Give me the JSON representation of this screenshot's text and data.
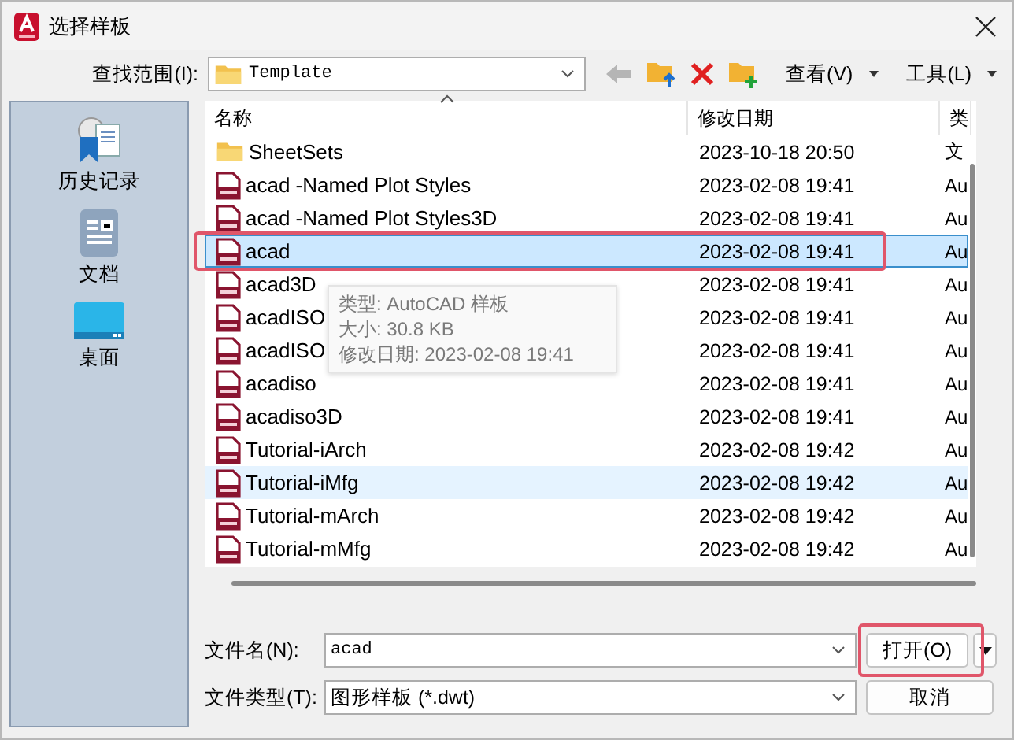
{
  "window": {
    "title": "选择样板"
  },
  "toolbar": {
    "look_in_label": "查找范围(I):",
    "look_in_value": "Template",
    "back_disabled": true,
    "view_menu": "查看(V)",
    "tools_menu": "工具(L)"
  },
  "places": [
    {
      "label": "历史记录",
      "kind": "history"
    },
    {
      "label": "文档",
      "kind": "documents"
    },
    {
      "label": "桌面",
      "kind": "desktop"
    }
  ],
  "file_list": {
    "columns": [
      "名称",
      "修改日期",
      "类"
    ],
    "rows": [
      {
        "name": "SheetSets",
        "kind": "folder",
        "modified": "2023-10-18 20:50",
        "type": "文",
        "selected": false,
        "hovered": false,
        "annotated": false
      },
      {
        "name": "acad -Named Plot Styles",
        "kind": "dwt",
        "modified": "2023-02-08 19:41",
        "type": "Au",
        "selected": false,
        "hovered": false,
        "annotated": false
      },
      {
        "name": "acad -Named Plot Styles3D",
        "kind": "dwt",
        "modified": "2023-02-08 19:41",
        "type": "Au",
        "selected": false,
        "hovered": false,
        "annotated": false
      },
      {
        "name": "acad",
        "kind": "dwt",
        "modified": "2023-02-08 19:41",
        "type": "Au",
        "selected": true,
        "hovered": false,
        "annotated": true
      },
      {
        "name": "acad3D",
        "kind": "dwt",
        "modified": "2023-02-08 19:41",
        "type": "Au",
        "selected": false,
        "hovered": false,
        "annotated": false
      },
      {
        "name": "acadISO",
        "kind": "dwt",
        "modified": "2023-02-08 19:41",
        "type": "Au",
        "selected": false,
        "hovered": false,
        "annotated": false
      },
      {
        "name": "acadISO",
        "kind": "dwt",
        "modified": "2023-02-08 19:41",
        "type": "Au",
        "selected": false,
        "hovered": false,
        "annotated": false
      },
      {
        "name": "acadiso",
        "kind": "dwt",
        "modified": "2023-02-08 19:41",
        "type": "Au",
        "selected": false,
        "hovered": false,
        "annotated": false
      },
      {
        "name": "acadiso3D",
        "kind": "dwt",
        "modified": "2023-02-08 19:41",
        "type": "Au",
        "selected": false,
        "hovered": false,
        "annotated": false
      },
      {
        "name": "Tutorial-iArch",
        "kind": "dwt",
        "modified": "2023-02-08 19:42",
        "type": "Au",
        "selected": false,
        "hovered": false,
        "annotated": false
      },
      {
        "name": "Tutorial-iMfg",
        "kind": "dwt",
        "modified": "2023-02-08 19:42",
        "type": "Au",
        "selected": false,
        "hovered": true,
        "annotated": false
      },
      {
        "name": "Tutorial-mArch",
        "kind": "dwt",
        "modified": "2023-02-08 19:42",
        "type": "Au",
        "selected": false,
        "hovered": false,
        "annotated": false
      },
      {
        "name": "Tutorial-mMfg",
        "kind": "dwt",
        "modified": "2023-02-08 19:42",
        "type": "Au",
        "selected": false,
        "hovered": false,
        "annotated": false
      }
    ]
  },
  "tooltip": {
    "lines": [
      "类型: AutoCAD 样板",
      "大小: 30.8 KB",
      "修改日期: 2023-02-08 19:41"
    ]
  },
  "file_name": {
    "label": "文件名(N):",
    "value": "acad"
  },
  "file_type": {
    "label": "文件类型(T):",
    "value": "图形样板 (*.dwt)"
  },
  "buttons": [
    {
      "label": "打开(O)",
      "kind": "open",
      "annotated": true
    },
    {
      "label": "取消",
      "kind": "cancel",
      "annotated": false
    }
  ]
}
